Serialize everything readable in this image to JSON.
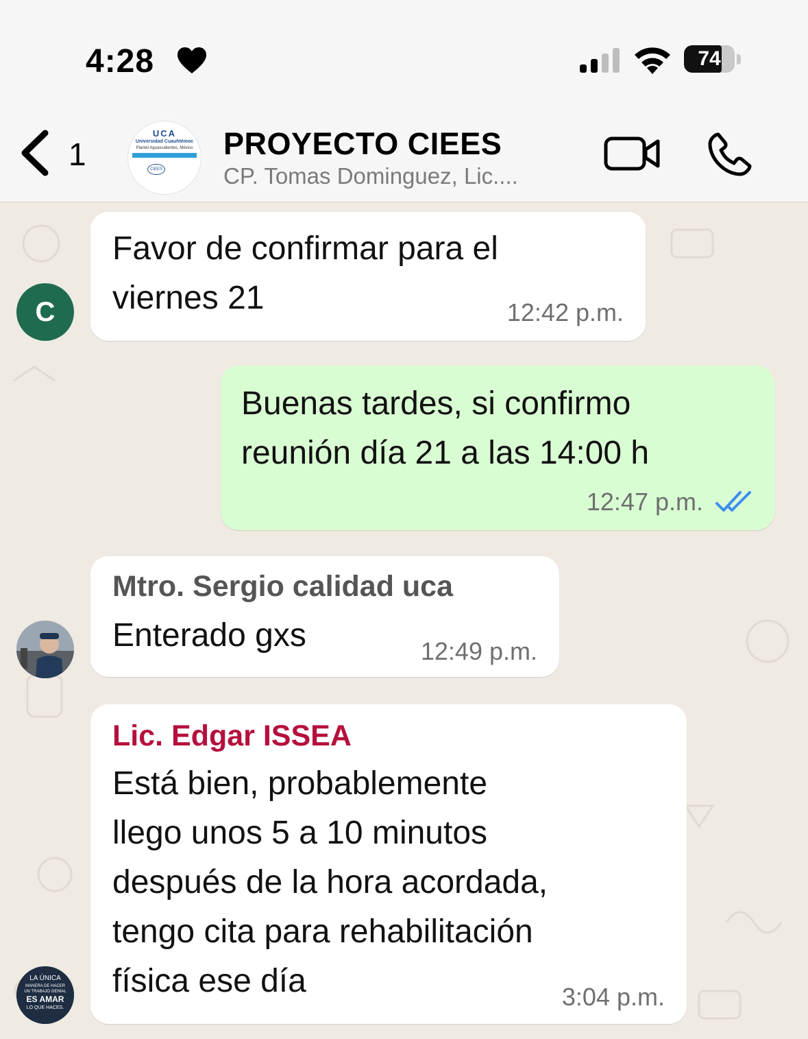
{
  "status_bar": {
    "time": "4:28",
    "battery_level": "74",
    "battery_fraction": 0.74,
    "icons": [
      "heart-icon",
      "signal-icon",
      "wifi-icon",
      "battery-icon"
    ]
  },
  "header": {
    "back_count": "1",
    "group_name": "PROYECTO CIEES",
    "members": "CP. Tomas Dominguez, Lic....",
    "avatar_text": {
      "uca": "UCA",
      "line1": "Universidad Cuauhtémoc",
      "line2": "Plantel Aguascalientes, México",
      "ciees": "CIEES"
    }
  },
  "messages": [
    {
      "direction": "in",
      "avatar_letter": "C",
      "text_lines": [
        "Favor de confirmar para el",
        "viernes 21"
      ],
      "time": "12:42 p.m."
    },
    {
      "direction": "out",
      "text_lines": [
        "Buenas tardes, si confirmo",
        "reunión día 21 a las 14:00 h"
      ],
      "time": "12:47 p.m.",
      "status": "read"
    },
    {
      "direction": "in",
      "sender": "Mtro. Sergio calidad uca",
      "text_lines": [
        "Enterado gxs"
      ],
      "time": "12:49 p.m."
    },
    {
      "direction": "in",
      "sender": "Lic. Edgar ISSEA",
      "text_lines": [
        "Está bien, probablemente",
        "llego unos 5 a 10 minutos",
        "después de la hora acordada,",
        "tengo cita para rehabilitación",
        "física ese día"
      ],
      "time": "3:04 p.m.",
      "avatar_text": [
        "LA ÚNICA",
        "MANERA DE HACER",
        "UN TRABAJO GENIAL",
        "ES AMAR",
        "LO QUE HACES."
      ]
    }
  ],
  "colors": {
    "chat_bg": "#efeae2",
    "outgoing_bubble": "#d9fdd3",
    "incoming_bubble": "#ffffff",
    "read_ticks": "#3b8ef0",
    "sender_sergio": "#555555",
    "sender_edgar": "#b5103d"
  }
}
